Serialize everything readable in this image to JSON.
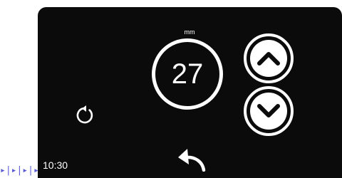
{
  "display": {
    "unit": "mm",
    "value": "27",
    "time": "10:30"
  },
  "controls": {
    "increase_icon": "chevron-up-icon",
    "decrease_icon": "chevron-down-icon",
    "refresh_icon": "refresh-icon",
    "back_icon": "back-arrow-icon"
  },
  "colors": {
    "panel": "#0b0b0b",
    "foreground": "#ffffff",
    "background_pattern": "#5b5bd6"
  }
}
